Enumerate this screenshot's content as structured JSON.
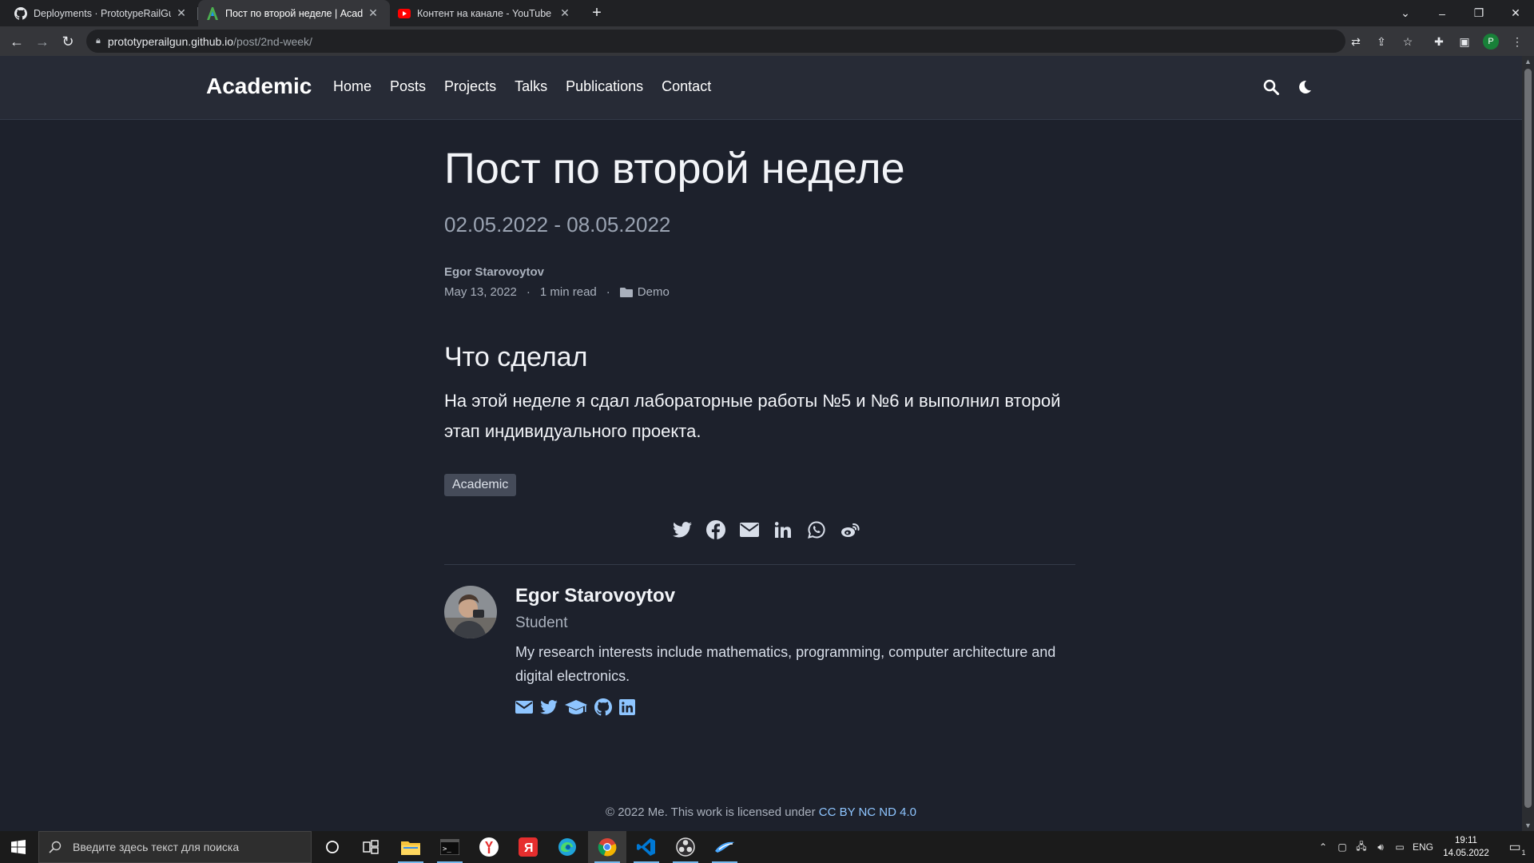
{
  "browser": {
    "tabs": [
      {
        "title": "Deployments · PrototypeRailGun",
        "icon": "github-icon"
      },
      {
        "title": "Пост по второй неделе | Academic",
        "icon": "academic-icon"
      },
      {
        "title": "Контент на канале - YouTube Studio",
        "icon": "youtube-icon"
      }
    ],
    "new_tab": "+",
    "url_host": "prototyperailgun.github.io",
    "url_path": "/post/2nd-week/",
    "profile_initial": "P"
  },
  "site": {
    "brand": "Academic",
    "nav": [
      "Home",
      "Posts",
      "Projects",
      "Talks",
      "Publications",
      "Contact"
    ]
  },
  "post": {
    "title": "Пост по второй неделе",
    "subtitle": "02.05.2022 - 08.05.2022",
    "author": "Egor Starovoytov",
    "date": "May 13, 2022",
    "reading_time": "1 min read",
    "category": "Demo",
    "meta_separator": "·",
    "heading": "Что сделал",
    "body": "На этой неделе я сдал лабораторные работы №5 и №6 и выполнил второй этап индивидуального проекта.",
    "tag": "Academic",
    "share_icons": [
      "twitter-icon",
      "facebook-icon",
      "email-icon",
      "linkedin-icon",
      "whatsapp-icon",
      "weibo-icon"
    ]
  },
  "author_card": {
    "name": "Egor Starovoytov",
    "role": "Student",
    "bio": "My research interests include mathematics, programming, computer architecture and digital electronics.",
    "links": [
      "email-icon",
      "twitter-icon",
      "graduation-cap-icon",
      "github-icon",
      "linkedin-icon"
    ]
  },
  "footer": {
    "text": "© 2022 Me. This work is licensed under ",
    "license": "CC BY NC ND 4.0"
  },
  "taskbar": {
    "search_placeholder": "Введите здесь текст для поиска",
    "language": "ENG",
    "time": "19:11",
    "date": "14.05.2022",
    "notification_count": "1"
  },
  "colors": {
    "page_bg": "#1d212c",
    "navbar_bg": "#272b36",
    "link": "#8ec5ff",
    "tag_bg": "#454b59"
  }
}
